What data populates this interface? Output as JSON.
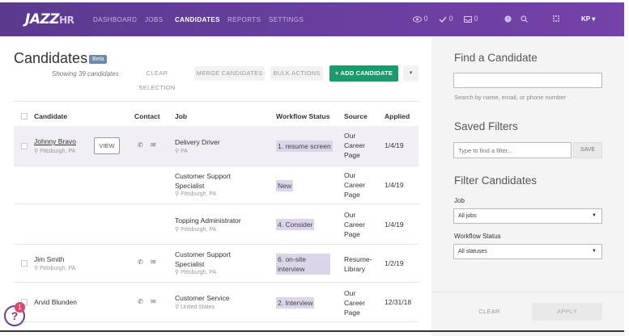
{
  "nav": {
    "logo": "JAZZ",
    "logo_suffix": "HR",
    "links": [
      "DASHBOARD",
      "JOBS",
      "CANDIDATES",
      "REPORTS",
      "SETTINGS"
    ],
    "active": "CANDIDATES",
    "counts": {
      "views": "0",
      "checks": "0",
      "inbox": "0"
    },
    "user": "KP ▾"
  },
  "header": {
    "title": "Candidates",
    "badge": "Beta",
    "showing": "Showing 39 candidates",
    "clear_selection": "CLEAR SELECTION",
    "merge": "MERGE CANDIDATES",
    "bulk": "BULK ACTIONS",
    "add": "+ ADD CANDIDATE",
    "caret": "▾"
  },
  "table": {
    "columns": [
      "Candidate",
      "Contact",
      "Job",
      "Workflow Status",
      "Source",
      "Applied"
    ],
    "view_label": "VIEW",
    "rows": [
      {
        "name": "Johnny Bravo",
        "location": "⚲ Pittsburgh, PA",
        "job": "Delivery Driver",
        "job_location": "⚲ PA",
        "status": "1. resume screen",
        "source": "Our Career Page",
        "applied": "1/4/19"
      },
      {
        "name": "",
        "location": "",
        "job": "Customer Support Specialist",
        "job_location": "⚲ Pittsburgh, PA",
        "status": "New",
        "source": "Our Career Page",
        "applied": "1/4/19"
      },
      {
        "name": "",
        "location": "",
        "job": "Topping Administrator",
        "job_location": "⚲ Pittsburgh, PA",
        "status": "4. Consider",
        "source": "Our Career Page",
        "applied": "1/4/19"
      },
      {
        "name": "Jim Smith",
        "location": "⚲ Pittsburgh, PA",
        "job": "Customer Support Specialist",
        "job_location": "⚲ Pittsburgh, PA",
        "status": "6. on-site interview",
        "source": "Resume-Library",
        "applied": "1/2/19"
      },
      {
        "name": "Arvid Blunden",
        "location": "",
        "job": "Customer Service",
        "job_location": "⚲ United States",
        "status": "2. Interview",
        "source": "Our Career Page",
        "applied": "12/31/18"
      }
    ]
  },
  "panel": {
    "find_title": "Find a Candidate",
    "find_hint": "Search by name, email, or phone number",
    "saved_title": "Saved Filters",
    "saved_placeholder": "Type to find a filter...",
    "save_label": "SAVE",
    "filter_title": "Filter Candidates",
    "job_label": "Job",
    "job_value": "All jobs",
    "workflow_label": "Workflow Status",
    "workflow_value": "All statuses",
    "clear": "CLEAR",
    "apply": "APPLY"
  },
  "help": {
    "badge": "1",
    "icon": "?"
  },
  "colors": {
    "nav": "#6a3fa0",
    "add_button": "#1c9a6c",
    "status_bg": "#dcd4e9"
  }
}
